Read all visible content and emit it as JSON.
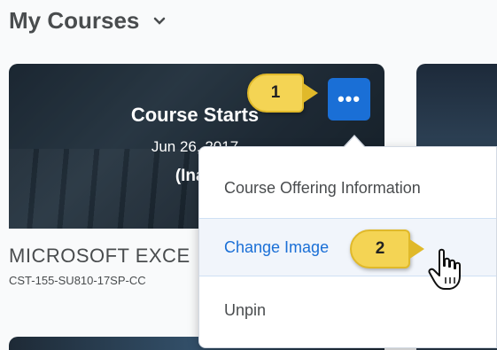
{
  "header": {
    "title": "My Courses",
    "chevron_icon": "chevron-down-icon"
  },
  "course_card": {
    "status_title": "Course Starts",
    "status_date": "Jun 26, 2017",
    "status_inactive": "(Inac",
    "name": "MICROSOFT EXCE",
    "code": "CST-155-SU810-17SP-CC"
  },
  "more_button": {
    "label": "•••",
    "icon": "more-options-icon"
  },
  "menu": {
    "items": [
      {
        "label": "Course Offering Information"
      },
      {
        "label": "Change Image"
      },
      {
        "label": "Unpin"
      }
    ]
  },
  "callouts": {
    "one": "1",
    "two": "2"
  },
  "colors": {
    "accent": "#1a6fd6",
    "callout": "#f4d454",
    "text": "#494c4e"
  }
}
